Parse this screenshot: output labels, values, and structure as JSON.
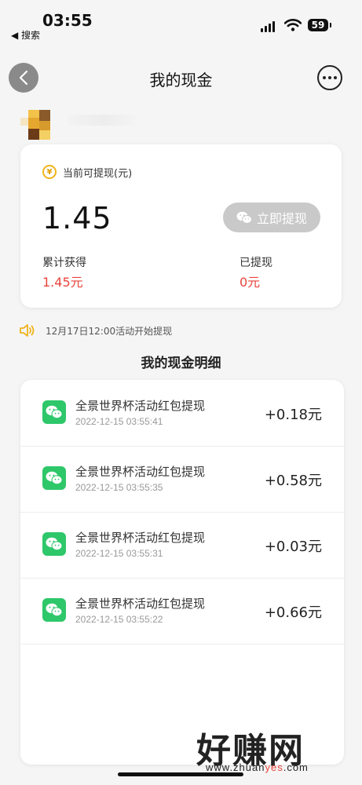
{
  "status_bar": {
    "time": "03:55",
    "back_app": "◀ 搜索",
    "battery": "59"
  },
  "navbar": {
    "title": "我的现金"
  },
  "balance": {
    "label": "当前可提现(元)",
    "amount": "1.45",
    "withdraw_button": "立即提现",
    "total_earned_label": "累计获得",
    "total_earned_value": "1.45元",
    "withdrawn_label": "已提现",
    "withdrawn_value": "0元"
  },
  "notice": {
    "text": "12月17日12:00活动开始提现"
  },
  "details": {
    "title": "我的现金明细",
    "items": [
      {
        "title": "全景世界杯活动红包提现",
        "time": "2022-12-15 03:55:41",
        "amount": "+0.18元"
      },
      {
        "title": "全景世界杯活动红包提现",
        "time": "2022-12-15 03:55:35",
        "amount": "+0.58元"
      },
      {
        "title": "全景世界杯活动红包提现",
        "time": "2022-12-15 03:55:31",
        "amount": "+0.03元"
      },
      {
        "title": "全景世界杯活动红包提现",
        "time": "2022-12-15 03:55:22",
        "amount": "+0.66元"
      }
    ]
  },
  "watermark": {
    "big": "好赚网",
    "small_a": "www.zhuan",
    "small_b": "yes",
    "small_c": ".com"
  },
  "colors": {
    "accent_red": "#e8453c",
    "wechat_green": "#2ec76a",
    "button_gray": "#c9c9c9",
    "yen_gold": "#f0b41c"
  },
  "icons": [
    "back-icon",
    "more-icon",
    "yen-icon",
    "wechat-icon",
    "speaker-icon"
  ]
}
